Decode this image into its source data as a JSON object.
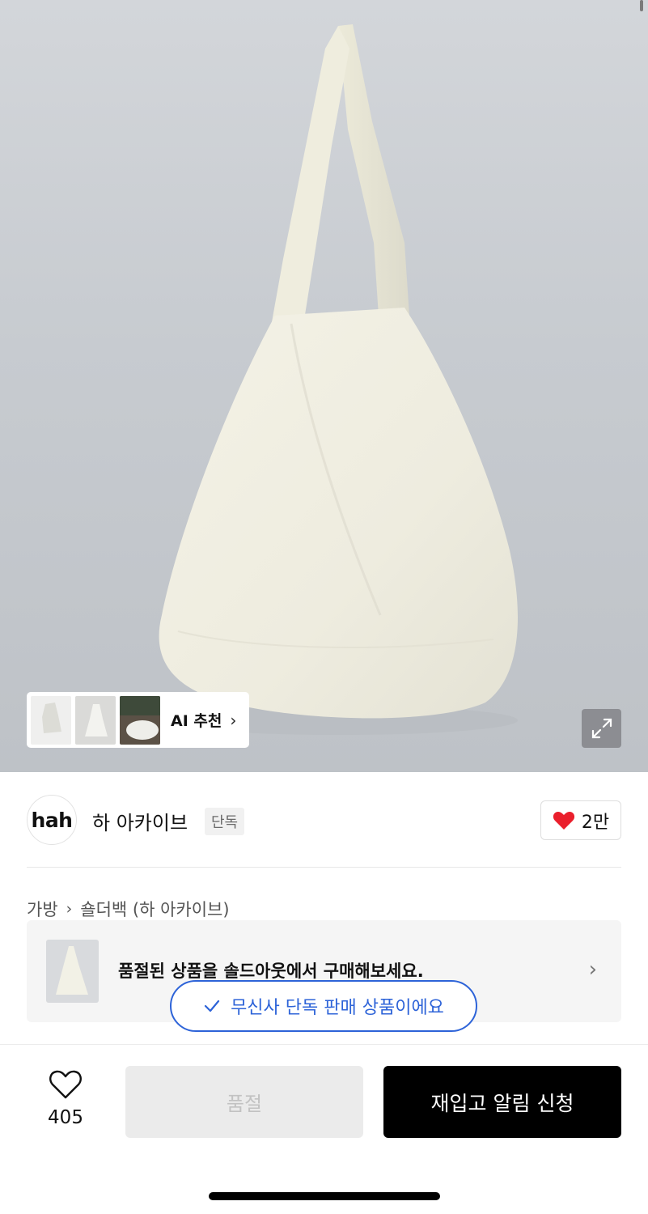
{
  "hero": {
    "ai_recommend_label": "AI 추천",
    "ai_chevron": "›",
    "icons": {
      "expand": "expand-icon"
    }
  },
  "brand": {
    "logo_text": "hah",
    "name": "하 아카이브",
    "badge": "단독",
    "like_count": "2만",
    "heart_color": "#ea1f2c"
  },
  "breadcrumb": {
    "items": [
      "가방",
      "숄더백 (하 아카이브)"
    ],
    "separator": "›"
  },
  "soldout_card": {
    "text": "품절된 상품을 솔드아웃에서 구매해보세요.",
    "chevron": "›"
  },
  "toast": {
    "text": "무신사 단독 판매 상품이에요",
    "accent": "#2d63d8"
  },
  "bottom_bar": {
    "favorite_count": "405",
    "soldout_label": "품절",
    "restock_label": "재입고 알림 신청"
  }
}
